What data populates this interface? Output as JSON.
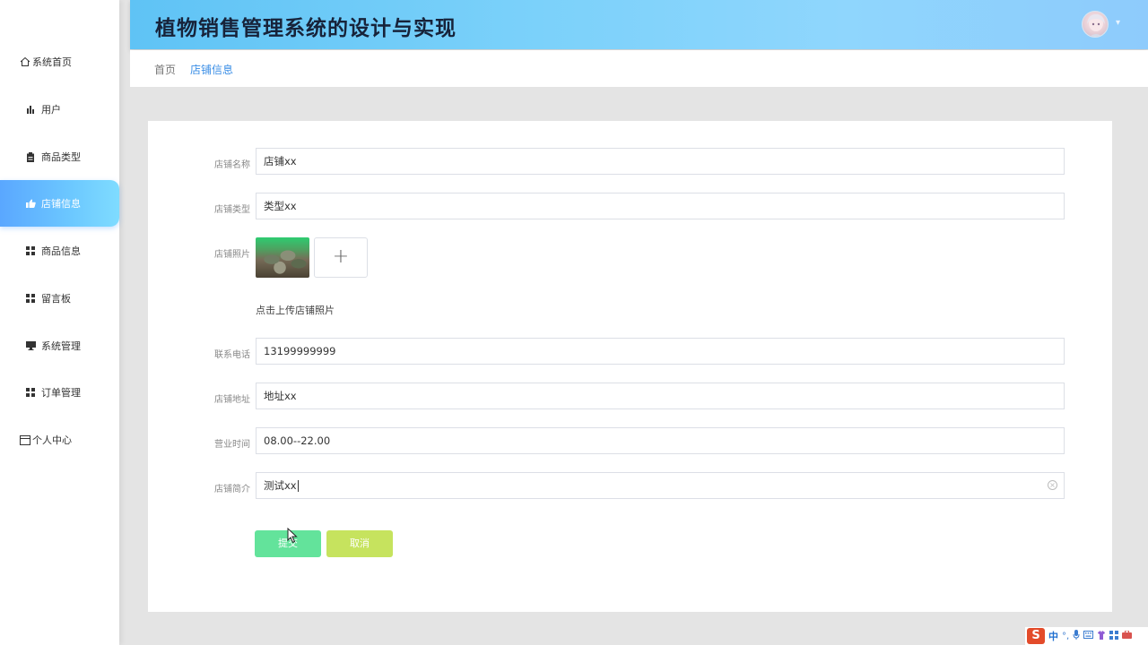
{
  "header": {
    "title": "植物销售管理系统的设计与实现",
    "avatar_caret": "▾"
  },
  "breadcrumb": {
    "home": "首页",
    "current": "店铺信息"
  },
  "sidebar": {
    "items": [
      {
        "label": "系统首页",
        "icon": "home-icon"
      },
      {
        "label": "用户",
        "icon": "bar-chart-icon"
      },
      {
        "label": "商品类型",
        "icon": "clipboard-icon"
      },
      {
        "label": "店铺信息",
        "icon": "thumb-up-icon",
        "active": true
      },
      {
        "label": "商品信息",
        "icon": "grid-icon"
      },
      {
        "label": "留言板",
        "icon": "grid-icon"
      },
      {
        "label": "系统管理",
        "icon": "monitor-icon"
      },
      {
        "label": "订单管理",
        "icon": "grid-icon"
      },
      {
        "label": "个人中心",
        "icon": "window-icon"
      }
    ]
  },
  "form": {
    "shop_name": {
      "label": "店铺名称",
      "value": "店铺xx"
    },
    "shop_type": {
      "label": "店铺类型",
      "value": "类型xx"
    },
    "shop_photo": {
      "label": "店铺照片",
      "upload_icon": "+",
      "hint": "点击上传店铺照片"
    },
    "phone": {
      "label": "联系电话",
      "value": "13199999999"
    },
    "address": {
      "label": "店铺地址",
      "value": "地址xx"
    },
    "hours": {
      "label": "营业时间",
      "value": "08.00--22.00"
    },
    "intro": {
      "label": "店铺简介",
      "value": "测试xx"
    },
    "submit_label": "提交",
    "cancel_label": "取消"
  },
  "ime_tray": {
    "logo": "S",
    "mode": "中",
    "punct": "°,"
  },
  "colors": {
    "header_gradient_start": "#5fc3f5",
    "active_nav": "#5aa7ff",
    "submit": "#63e39b",
    "cancel": "#c6e35e",
    "breadcrumb_active": "#3a8ee6"
  }
}
